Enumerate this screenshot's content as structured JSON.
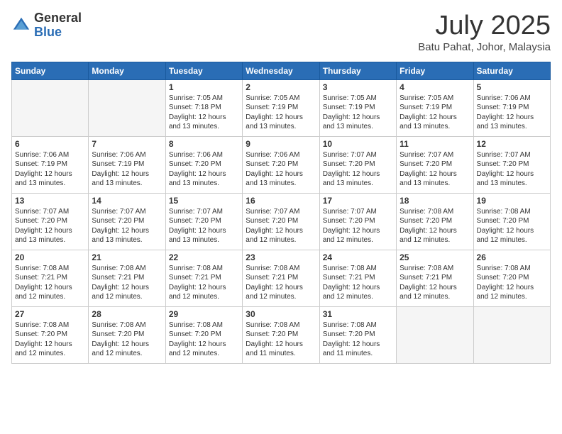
{
  "header": {
    "logo_general": "General",
    "logo_blue": "Blue",
    "month_title": "July 2025",
    "subtitle": "Batu Pahat, Johor, Malaysia"
  },
  "weekdays": [
    "Sunday",
    "Monday",
    "Tuesday",
    "Wednesday",
    "Thursday",
    "Friday",
    "Saturday"
  ],
  "weeks": [
    [
      {
        "day": "",
        "info": ""
      },
      {
        "day": "",
        "info": ""
      },
      {
        "day": "1",
        "info": "Sunrise: 7:05 AM\nSunset: 7:18 PM\nDaylight: 12 hours\nand 13 minutes."
      },
      {
        "day": "2",
        "info": "Sunrise: 7:05 AM\nSunset: 7:19 PM\nDaylight: 12 hours\nand 13 minutes."
      },
      {
        "day": "3",
        "info": "Sunrise: 7:05 AM\nSunset: 7:19 PM\nDaylight: 12 hours\nand 13 minutes."
      },
      {
        "day": "4",
        "info": "Sunrise: 7:05 AM\nSunset: 7:19 PM\nDaylight: 12 hours\nand 13 minutes."
      },
      {
        "day": "5",
        "info": "Sunrise: 7:06 AM\nSunset: 7:19 PM\nDaylight: 12 hours\nand 13 minutes."
      }
    ],
    [
      {
        "day": "6",
        "info": "Sunrise: 7:06 AM\nSunset: 7:19 PM\nDaylight: 12 hours\nand 13 minutes."
      },
      {
        "day": "7",
        "info": "Sunrise: 7:06 AM\nSunset: 7:19 PM\nDaylight: 12 hours\nand 13 minutes."
      },
      {
        "day": "8",
        "info": "Sunrise: 7:06 AM\nSunset: 7:20 PM\nDaylight: 12 hours\nand 13 minutes."
      },
      {
        "day": "9",
        "info": "Sunrise: 7:06 AM\nSunset: 7:20 PM\nDaylight: 12 hours\nand 13 minutes."
      },
      {
        "day": "10",
        "info": "Sunrise: 7:07 AM\nSunset: 7:20 PM\nDaylight: 12 hours\nand 13 minutes."
      },
      {
        "day": "11",
        "info": "Sunrise: 7:07 AM\nSunset: 7:20 PM\nDaylight: 12 hours\nand 13 minutes."
      },
      {
        "day": "12",
        "info": "Sunrise: 7:07 AM\nSunset: 7:20 PM\nDaylight: 12 hours\nand 13 minutes."
      }
    ],
    [
      {
        "day": "13",
        "info": "Sunrise: 7:07 AM\nSunset: 7:20 PM\nDaylight: 12 hours\nand 13 minutes."
      },
      {
        "day": "14",
        "info": "Sunrise: 7:07 AM\nSunset: 7:20 PM\nDaylight: 12 hours\nand 13 minutes."
      },
      {
        "day": "15",
        "info": "Sunrise: 7:07 AM\nSunset: 7:20 PM\nDaylight: 12 hours\nand 13 minutes."
      },
      {
        "day": "16",
        "info": "Sunrise: 7:07 AM\nSunset: 7:20 PM\nDaylight: 12 hours\nand 12 minutes."
      },
      {
        "day": "17",
        "info": "Sunrise: 7:07 AM\nSunset: 7:20 PM\nDaylight: 12 hours\nand 12 minutes."
      },
      {
        "day": "18",
        "info": "Sunrise: 7:08 AM\nSunset: 7:20 PM\nDaylight: 12 hours\nand 12 minutes."
      },
      {
        "day": "19",
        "info": "Sunrise: 7:08 AM\nSunset: 7:20 PM\nDaylight: 12 hours\nand 12 minutes."
      }
    ],
    [
      {
        "day": "20",
        "info": "Sunrise: 7:08 AM\nSunset: 7:21 PM\nDaylight: 12 hours\nand 12 minutes."
      },
      {
        "day": "21",
        "info": "Sunrise: 7:08 AM\nSunset: 7:21 PM\nDaylight: 12 hours\nand 12 minutes."
      },
      {
        "day": "22",
        "info": "Sunrise: 7:08 AM\nSunset: 7:21 PM\nDaylight: 12 hours\nand 12 minutes."
      },
      {
        "day": "23",
        "info": "Sunrise: 7:08 AM\nSunset: 7:21 PM\nDaylight: 12 hours\nand 12 minutes."
      },
      {
        "day": "24",
        "info": "Sunrise: 7:08 AM\nSunset: 7:21 PM\nDaylight: 12 hours\nand 12 minutes."
      },
      {
        "day": "25",
        "info": "Sunrise: 7:08 AM\nSunset: 7:21 PM\nDaylight: 12 hours\nand 12 minutes."
      },
      {
        "day": "26",
        "info": "Sunrise: 7:08 AM\nSunset: 7:20 PM\nDaylight: 12 hours\nand 12 minutes."
      }
    ],
    [
      {
        "day": "27",
        "info": "Sunrise: 7:08 AM\nSunset: 7:20 PM\nDaylight: 12 hours\nand 12 minutes."
      },
      {
        "day": "28",
        "info": "Sunrise: 7:08 AM\nSunset: 7:20 PM\nDaylight: 12 hours\nand 12 minutes."
      },
      {
        "day": "29",
        "info": "Sunrise: 7:08 AM\nSunset: 7:20 PM\nDaylight: 12 hours\nand 12 minutes."
      },
      {
        "day": "30",
        "info": "Sunrise: 7:08 AM\nSunset: 7:20 PM\nDaylight: 12 hours\nand 11 minutes."
      },
      {
        "day": "31",
        "info": "Sunrise: 7:08 AM\nSunset: 7:20 PM\nDaylight: 12 hours\nand 11 minutes."
      },
      {
        "day": "",
        "info": ""
      },
      {
        "day": "",
        "info": ""
      }
    ]
  ]
}
